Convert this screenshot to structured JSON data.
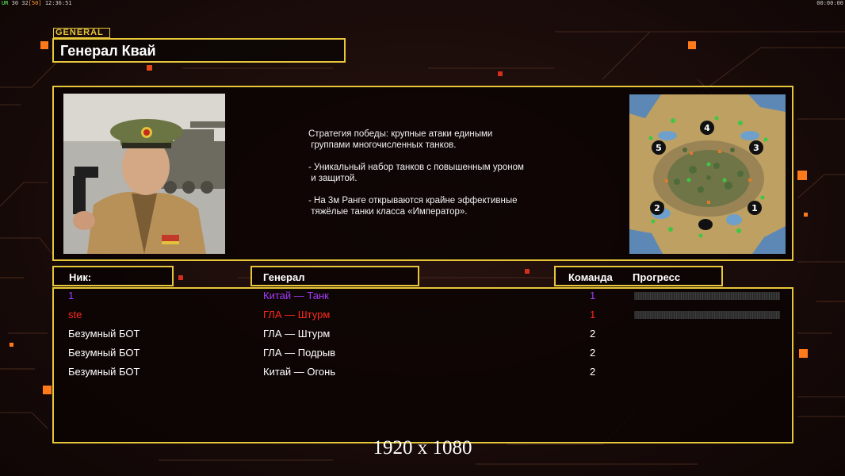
{
  "status": {
    "top_left_ur": "UR",
    "top_left_nums": "30 32",
    "top_left_bracket": "[50]",
    "top_left_time": "12:36:51",
    "top_right_time": "00:00:00"
  },
  "header": {
    "tag": "GENERAL",
    "title": "Генерал Квай"
  },
  "info": {
    "strategy_text": "Стратегия победы: крупные атаки едиными\n группами многочисленных танков.\n\n- Уникальный набор танков с повышенным уроном\n и защитой.\n\n- На 3м Ранге открываются крайне эффективные\n тяжёлые танки класса «Император».",
    "map_slots": [
      "1",
      "2",
      "3",
      "4",
      "5"
    ]
  },
  "table": {
    "headers": {
      "nick": "Ник:",
      "general": "Генерал",
      "team": "Команда",
      "progress": "Прогресс"
    },
    "rows": [
      {
        "nick": "1",
        "general": "Китай — Танк",
        "team": "1",
        "color": "#a53bff",
        "show_progress": true
      },
      {
        "nick": "ste",
        "general": "ГЛА — Штурм",
        "team": "1",
        "color": "#ff2a1e",
        "show_progress": true
      },
      {
        "nick": "Безумный БОТ",
        "general": "ГЛА — Штурм",
        "team": "2",
        "color": "#ffffff",
        "show_progress": false
      },
      {
        "nick": "Безумный БОТ",
        "general": "ГЛА — Подрыв",
        "team": "2",
        "color": "#ffffff",
        "show_progress": false
      },
      {
        "nick": "Безумный БОТ",
        "general": "Китай — Огонь",
        "team": "2",
        "color": "#ffffff",
        "show_progress": false
      }
    ]
  },
  "footer": {
    "resolution": "1920 x 1080"
  },
  "colors": {
    "frame": "#e7c63a",
    "accent_orange": "#ff7a1a",
    "accent_red": "#d0301c"
  }
}
